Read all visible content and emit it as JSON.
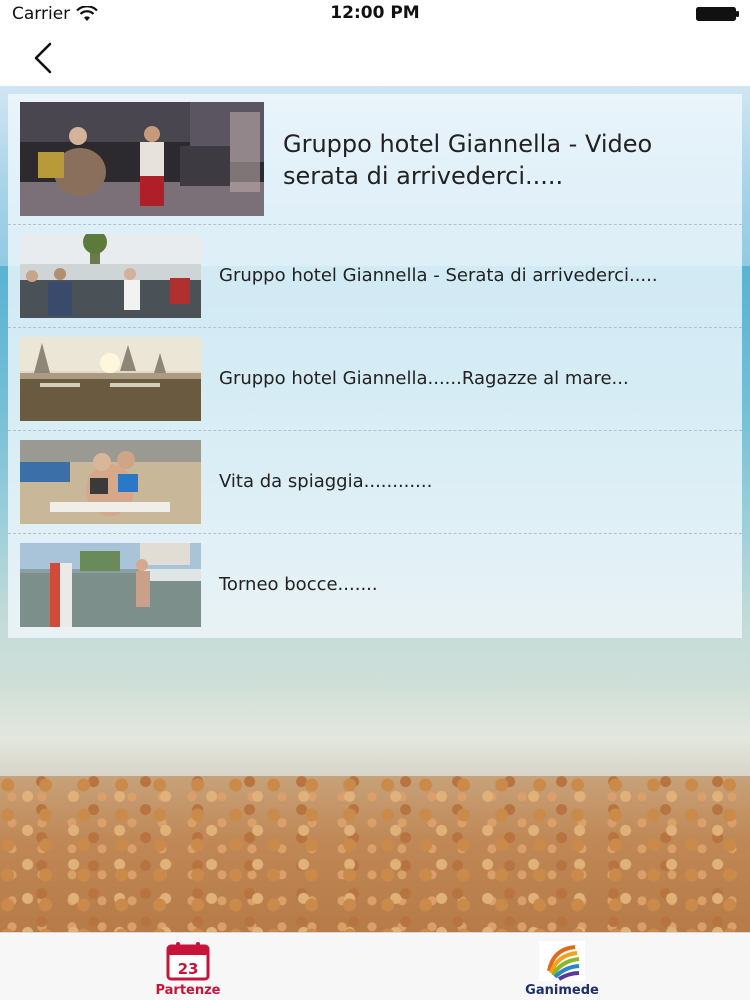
{
  "status_bar": {
    "carrier": "Carrier",
    "time": "12:00 PM"
  },
  "nav_bar": {
    "back_icon": "chevron-left-icon"
  },
  "items": [
    {
      "title": "Gruppo hotel Giannella - Video serata di arrivederci.....",
      "thumbnail": "night-party-thumbnail"
    },
    {
      "title": "Gruppo hotel Giannella - Serata di arrivederci.....",
      "thumbnail": "evening-gathering-thumbnail"
    },
    {
      "title": "Gruppo hotel Giannella......Ragazze al mare...",
      "thumbnail": "beach-umbrellas-thumbnail"
    },
    {
      "title": "Vita da spiaggia............",
      "thumbnail": "beach-life-thumbnail"
    },
    {
      "title": "Torneo bocce.......",
      "thumbnail": "bocce-court-thumbnail"
    }
  ],
  "tab_bar": {
    "tabs": [
      {
        "label": "Partenze",
        "icon": "calendar-icon",
        "icon_text": "23",
        "color": "#c8143a"
      },
      {
        "label": "Ganimede",
        "icon": "ganimede-logo-icon",
        "color": "#1d2f6b"
      }
    ]
  }
}
